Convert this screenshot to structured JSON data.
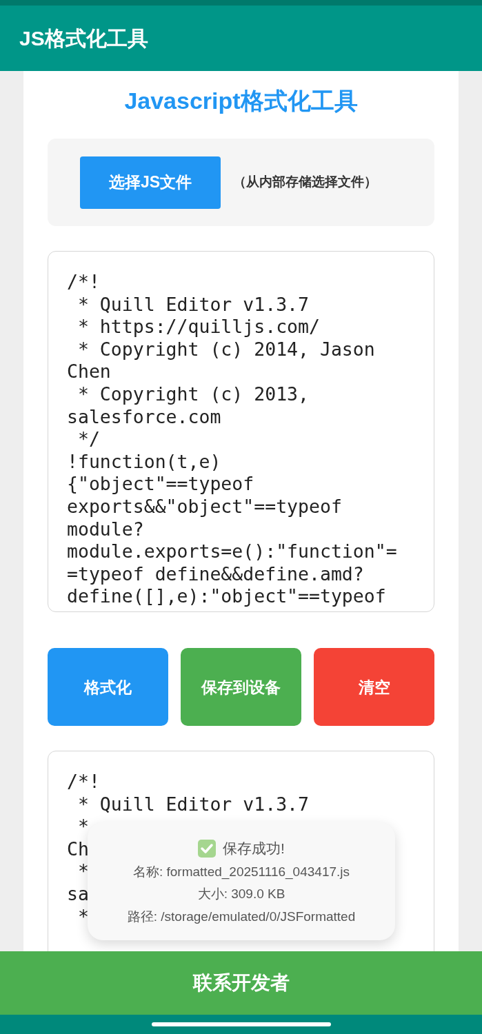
{
  "app_bar": {
    "title": "JS格式化工具"
  },
  "card": {
    "title": "Javascript格式化工具",
    "file_picker": {
      "button": "选择JS文件",
      "hint": "（从内部存储选择文件）"
    },
    "input_code": {
      "lines": [
        "/*!",
        " * Quill Editor v1.3.7",
        " * https://quilljs.com/",
        " * Copyright (c) 2014, Jason",
        "Chen",
        " * Copyright (c) 2013,",
        "salesforce.com",
        " */",
        "!function(t,e)",
        "{\"object\"==typeof",
        "exports&&\"object\"==typeof",
        "module?",
        "module.exports=e():\"function\"=",
        "=typeof define&&define.amd?",
        "define([],e):\"object\"==typeof"
      ]
    },
    "actions": [
      {
        "label": "格式化",
        "kind": "primary"
      },
      {
        "label": "保存到设备",
        "kind": "success"
      },
      {
        "label": "清空",
        "kind": "danger"
      }
    ],
    "output_code": {
      "lines": [
        "/*!",
        " * Quill Editor v1.3.7",
        " *",
        "Ch",
        " *",
        "sa",
        " *"
      ]
    }
  },
  "toast": {
    "title": "保存成功!",
    "lines": [
      "名称: formatted_20251116_043417.js",
      "大小: 309.0 KB",
      "路径: /storage/emulated/0/JSFormatted"
    ]
  },
  "bottom_button": "联系开发者"
}
